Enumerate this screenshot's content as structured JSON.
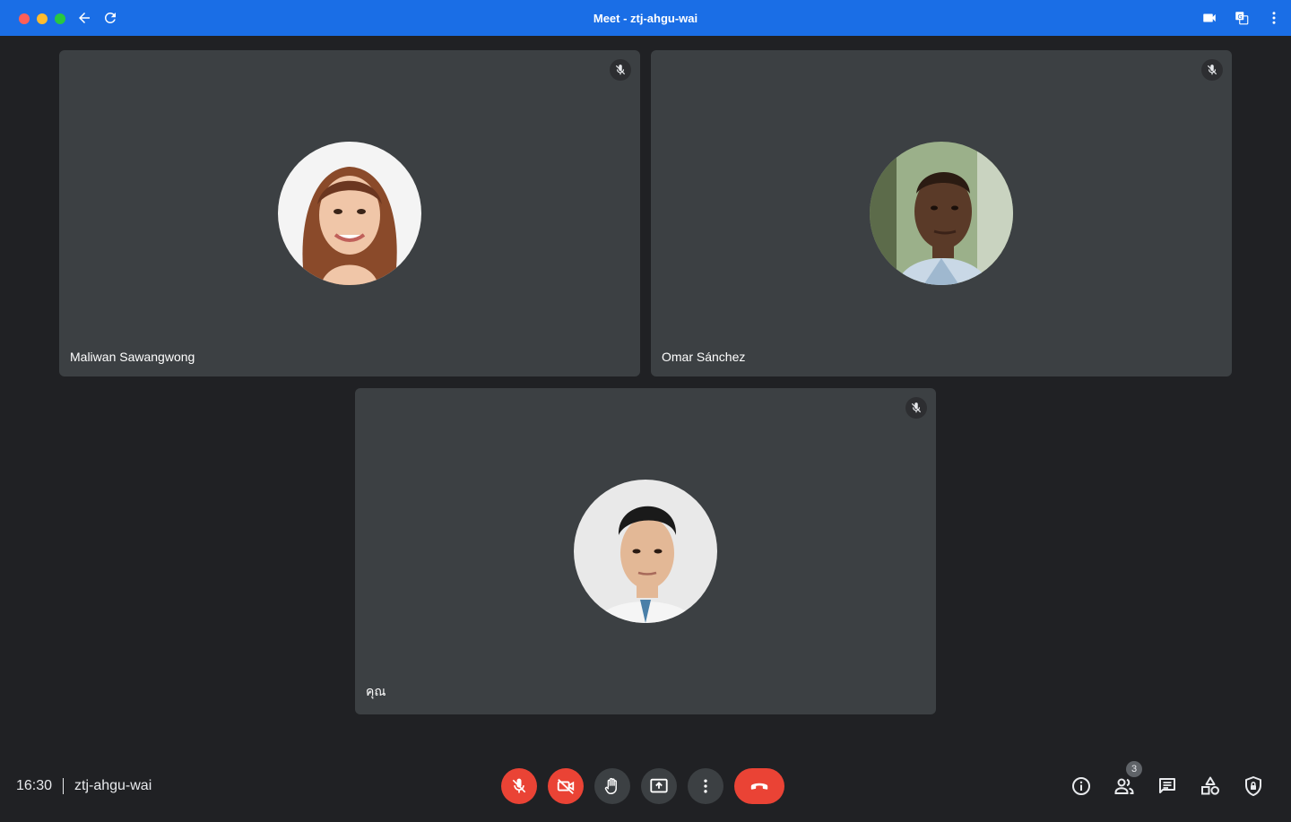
{
  "window": {
    "title": "Meet - ztj-ahgu-wai"
  },
  "participants": [
    {
      "name": "Maliwan Sawangwong",
      "muted": true
    },
    {
      "name": "Omar Sánchez",
      "muted": true
    },
    {
      "name": "คุณ",
      "muted": true
    }
  ],
  "footer": {
    "time": "16:30",
    "meeting_code": "ztj-ahgu-wai",
    "people_count": "3"
  },
  "colors": {
    "titlebar": "#1a6ee6",
    "background": "#202124",
    "tile": "#3c4043",
    "danger": "#ea4335"
  },
  "icons": {
    "controls": [
      "mic-off-icon",
      "camera-off-icon",
      "raise-hand-icon",
      "present-icon",
      "more-options-icon",
      "leave-call-icon"
    ],
    "right": [
      "info-icon",
      "people-icon",
      "chat-icon",
      "activities-icon",
      "host-controls-icon"
    ]
  }
}
